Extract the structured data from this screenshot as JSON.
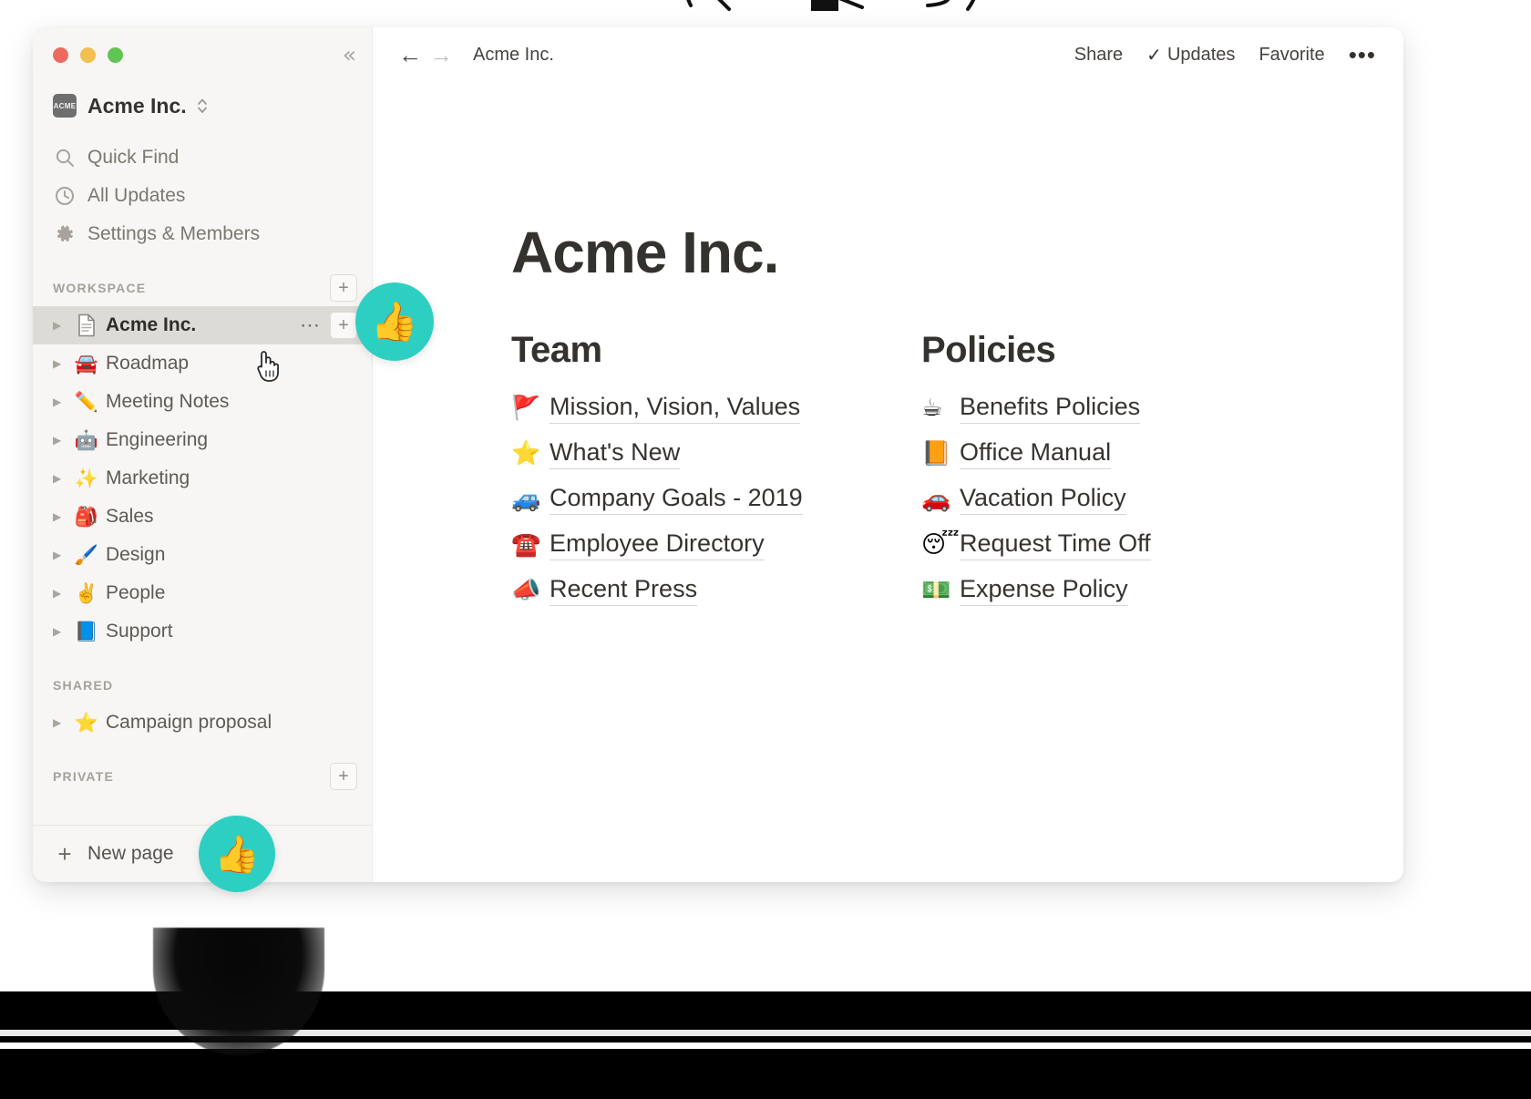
{
  "window": {
    "traffic_lights": [
      "close",
      "minimize",
      "maximize"
    ],
    "collapse_icon": "double-chevron-left"
  },
  "sidebar": {
    "workspace_switcher": {
      "logo_text": "ACME",
      "name": "Acme Inc.",
      "chevron_icon": "chevron-up-down"
    },
    "nav": [
      {
        "icon": "search-icon",
        "label": "Quick Find"
      },
      {
        "icon": "clock-icon",
        "label": "All Updates"
      },
      {
        "icon": "gear-icon",
        "label": "Settings & Members"
      }
    ],
    "sections": [
      {
        "title": "WORKSPACE",
        "has_add_button": true,
        "add_label": "+",
        "items": [
          {
            "emoji": "",
            "icon": "document-icon",
            "label": "Acme Inc.",
            "active": true,
            "has_dots": true,
            "has_plus": true
          },
          {
            "emoji": "🚘",
            "label": "Roadmap",
            "active": false
          },
          {
            "emoji": "✏️",
            "label": "Meeting Notes",
            "active": false
          },
          {
            "emoji": "🤖",
            "label": "Engineering",
            "active": false
          },
          {
            "emoji": "✨",
            "label": "Marketing",
            "active": false
          },
          {
            "emoji": "🎒",
            "label": "Sales",
            "active": false
          },
          {
            "emoji": "🖌️",
            "label": "Design",
            "active": false
          },
          {
            "emoji": "✌️",
            "label": "People",
            "active": false
          },
          {
            "emoji": "📘",
            "label": "Support",
            "active": false
          }
        ]
      },
      {
        "title": "SHARED",
        "has_add_button": false,
        "items": [
          {
            "emoji": "⭐",
            "label": "Campaign proposal",
            "active": false
          }
        ]
      },
      {
        "title": "PRIVATE",
        "has_add_button": true,
        "add_label": "+",
        "items": []
      }
    ],
    "footer": {
      "plus": "+",
      "label": "New page"
    }
  },
  "topbar": {
    "back_icon": "arrow-left",
    "forward_icon": "arrow-right",
    "breadcrumb": "Acme Inc.",
    "share_label": "Share",
    "updates_label": "Updates",
    "updates_check": "✓",
    "favorite_label": "Favorite",
    "more_label": "•••"
  },
  "page": {
    "title": "Acme Inc.",
    "columns": [
      {
        "heading": "Team",
        "links": [
          {
            "emoji": "🚩",
            "label": "Mission, Vision, Values"
          },
          {
            "emoji": "⭐",
            "label": "What's New"
          },
          {
            "emoji": "🚙",
            "label": "Company Goals - 2019"
          },
          {
            "emoji": "☎️",
            "label": "Employee Directory"
          },
          {
            "emoji": "📣",
            "label": "Recent Press"
          }
        ]
      },
      {
        "heading": "Policies",
        "links": [
          {
            "emoji": "☕",
            "label": "Benefits Policies"
          },
          {
            "emoji": "📙",
            "label": "Office Manual"
          },
          {
            "emoji": "🚗",
            "label": "Vacation Policy"
          },
          {
            "emoji": "😴",
            "label": "Request Time Off"
          },
          {
            "emoji": "💵",
            "label": "Expense Policy"
          }
        ]
      }
    ]
  },
  "annotations": {
    "accent_color": "#2ecfc3",
    "badges": [
      {
        "emoji": "👍",
        "position": "sidebar-workspace-row"
      },
      {
        "emoji": "👍",
        "position": "sidebar-new-page"
      }
    ]
  },
  "colors": {
    "sidebar_bg": "#f7f6f4",
    "active_row": "#dddbd6",
    "text_primary": "#34322e",
    "text_muted": "#a5a19a",
    "accent": "#2ecfc3",
    "band": "#000000"
  }
}
